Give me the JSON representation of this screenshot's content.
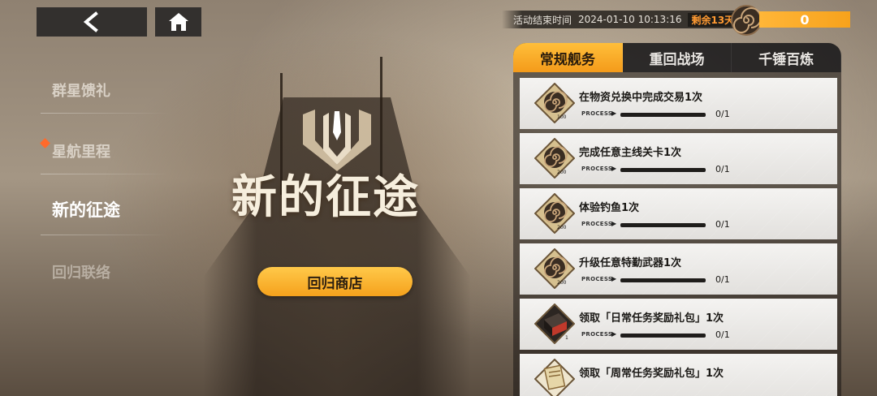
{
  "hero": {
    "title": "新的征途",
    "shop_button": "回归商店"
  },
  "nav": {
    "items": [
      {
        "label": "群星馈礼"
      },
      {
        "label": "星航里程"
      },
      {
        "label": "新的征途"
      },
      {
        "label": "回归联络"
      }
    ]
  },
  "event": {
    "end_label": "活动结束时间",
    "end_time": "2024-01-10 10:13:16",
    "remaining": "剩余13天"
  },
  "currency": {
    "value": "0"
  },
  "tabs": [
    {
      "label": "常规舰务",
      "active": true
    },
    {
      "label": "重回战场",
      "active": false
    },
    {
      "label": "千锤百炼",
      "active": false
    }
  ],
  "tasks": [
    {
      "title": "在物资兑换中完成交易1次",
      "process_label": "PROCESS",
      "count": "0/1",
      "reward_amount": "100",
      "icon": "coin-icon"
    },
    {
      "title": "完成任意主线关卡1次",
      "process_label": "PROCESS",
      "count": "0/1",
      "reward_amount": "200",
      "icon": "coin-icon"
    },
    {
      "title": "体验钓鱼1次",
      "process_label": "PROCESS",
      "count": "0/1",
      "reward_amount": "200",
      "icon": "coin-icon"
    },
    {
      "title": "升级任意特勤武器1次",
      "process_label": "PROCESS",
      "count": "0/1",
      "reward_amount": "200",
      "icon": "coin-icon"
    },
    {
      "title": "领取「日常任务奖励礼包」1次",
      "process_label": "PROCESS",
      "count": "0/1",
      "reward_amount": "1",
      "icon": "crate-icon"
    },
    {
      "title": "领取「周常任务奖励礼包」1次",
      "process_label": "",
      "count": "",
      "reward_amount": "",
      "icon": "ticket-icon"
    }
  ],
  "colors": {
    "accent": "#f7a21c",
    "highlight_dot": "#ff6a2b"
  }
}
